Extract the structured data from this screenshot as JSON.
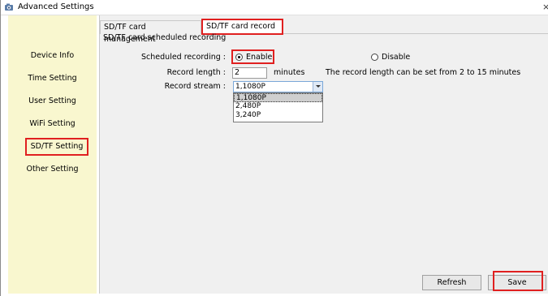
{
  "window": {
    "title": "Advanced Settings",
    "close_glyph": "×"
  },
  "sidebar": {
    "items": [
      {
        "label": "Device Info"
      },
      {
        "label": "Time Setting"
      },
      {
        "label": "User Setting"
      },
      {
        "label": "WiFi Setting"
      },
      {
        "label": "SD/TF Setting",
        "active": true
      },
      {
        "label": "Other Setting"
      }
    ]
  },
  "tabs": [
    {
      "label": "SD/TF card management"
    },
    {
      "label": "SD/TF card record",
      "selected": true
    }
  ],
  "form": {
    "group_title": "SD/TF card scheduled recording",
    "scheduled_label": "Scheduled recording :",
    "enable_label": "Enable",
    "disable_label": "Disable",
    "scheduled_value": "Enable",
    "length_label": "Record length :",
    "length_value": "2",
    "length_unit": "minutes",
    "length_hint": "The record length can be set from 2 to 15 minutes",
    "stream_label": "Record stream :",
    "stream_value": "1,1080P",
    "stream_options": [
      "1,1080P",
      "2,480P",
      "3,240P"
    ]
  },
  "buttons": {
    "refresh": "Refresh",
    "save": "Save"
  },
  "colors": {
    "sidebar_bg": "#f9f7cf",
    "highlight_red": "#e02020",
    "panel_bg": "#f0f0f0"
  }
}
